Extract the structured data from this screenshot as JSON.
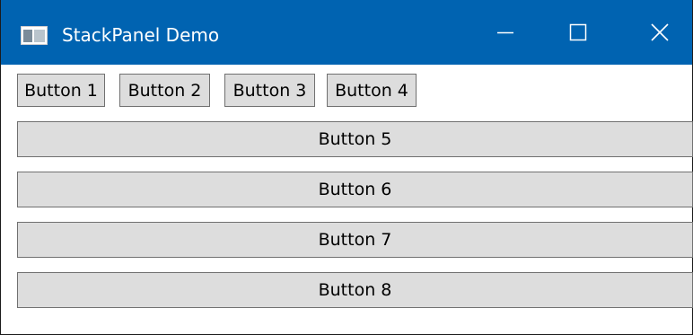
{
  "window": {
    "title": "StackPanel Demo",
    "icon": "window-app-icon",
    "title_bar_color": "#0063b1",
    "controls": {
      "minimize_icon": "minimize-icon",
      "maximize_icon": "maximize-icon",
      "close_icon": "close-icon"
    }
  },
  "horizontal_panel": {
    "buttons": [
      "Button 1",
      "Button 2",
      "Button 3",
      "Button 4"
    ]
  },
  "vertical_panel": {
    "buttons": [
      "Button 5",
      "Button 6",
      "Button 7",
      "Button 8"
    ]
  },
  "colors": {
    "button_background": "#dddddd",
    "button_border": "#707070"
  }
}
